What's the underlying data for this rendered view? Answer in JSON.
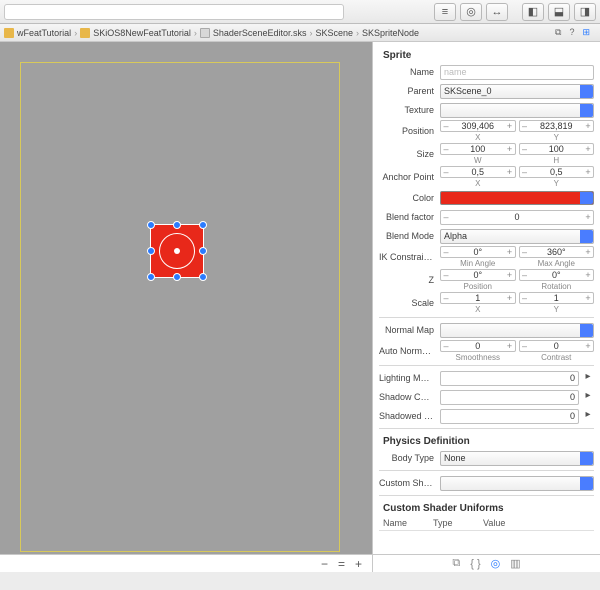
{
  "breadcrumbs": [
    "wFeatTutorial",
    "SKiOS8NewFeatTutorial",
    "ShaderSceneEditor.sks",
    "SKScene",
    "SKSpriteNode"
  ],
  "inspector": {
    "title": "Sprite",
    "name": {
      "label": "Name",
      "placeholder": "name"
    },
    "parent": {
      "label": "Parent",
      "value": "SKScene_0"
    },
    "texture": {
      "label": "Texture",
      "value": ""
    },
    "position": {
      "label": "Position",
      "x": "309,406",
      "xsub": "X",
      "y": "823,819",
      "ysub": "Y"
    },
    "size": {
      "label": "Size",
      "w": "100",
      "wsub": "W",
      "h": "100",
      "hsub": "H"
    },
    "anchor": {
      "label": "Anchor Point",
      "x": "0,5",
      "xsub": "X",
      "y": "0,5",
      "ysub": "Y"
    },
    "color": {
      "label": "Color",
      "hex": "#e8281a"
    },
    "blendfactor": {
      "label": "Blend factor",
      "value": "0"
    },
    "blendmode": {
      "label": "Blend Mode",
      "value": "Alpha"
    },
    "ik": {
      "label": "IK Constraints",
      "min": "0°",
      "minsub": "Min Angle",
      "max": "360°",
      "maxsub": "Max Angle"
    },
    "z": {
      "label": "Z",
      "pos": "0°",
      "possub": "Position",
      "rot": "0°",
      "rotsub": "Rotation"
    },
    "scale": {
      "label": "Scale",
      "x": "1",
      "xsub": "X",
      "y": "1",
      "ysub": "Y"
    },
    "normalmap": {
      "label": "Normal Map",
      "value": ""
    },
    "autonormal": {
      "label": "Auto Normal...",
      "s": "0",
      "ssub": "Smoothness",
      "c": "0",
      "csub": "Contrast"
    },
    "lightingmask": {
      "label": "Lighting Mask",
      "value": "0"
    },
    "shadowcast": {
      "label": "Shadow Cast...",
      "value": "0"
    },
    "shadowedm": {
      "label": "Shadowed M...",
      "value": "0"
    },
    "physics_title": "Physics Definition",
    "bodytype": {
      "label": "Body Type",
      "value": "None"
    },
    "customshader": {
      "label": "Custom Shader",
      "value": ""
    },
    "uniforms_title": "Custom Shader Uniforms",
    "uniforms_cols": [
      "Name",
      "Type",
      "Value"
    ]
  },
  "zoom": {
    "minus": "−",
    "eq": "=",
    "plus": "+"
  }
}
